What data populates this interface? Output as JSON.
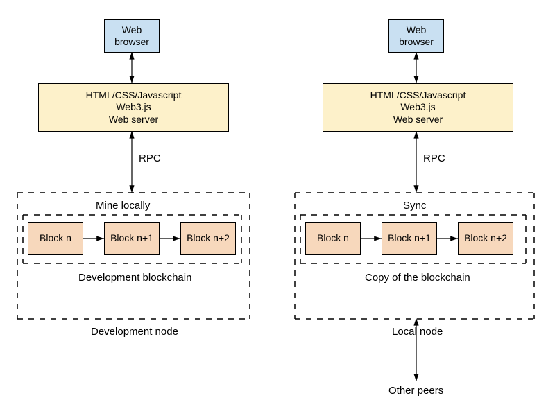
{
  "left": {
    "browser": "Web browser",
    "server_line1": "HTML/CSS/Javascript",
    "server_line2": "Web3.js",
    "server_line3": "Web server",
    "rpc": "RPC",
    "mine_local": "Mine locally",
    "blocks": {
      "b0": "Block n",
      "b1": "Block n+1",
      "b2": "Block n+2"
    },
    "chain": "Development blockchain",
    "node": "Development node"
  },
  "right": {
    "browser": "Web browser",
    "server_line1": "HTML/CSS/Javascript",
    "server_line2": "Web3.js",
    "server_line3": "Web server",
    "rpc": "RPC",
    "sync": "Sync",
    "blocks": {
      "b0": "Block n",
      "b1": "Block n+1",
      "b2": "Block n+2"
    },
    "chain": "Copy of the blockchain",
    "node": "Local node"
  },
  "peers": "Other peers"
}
